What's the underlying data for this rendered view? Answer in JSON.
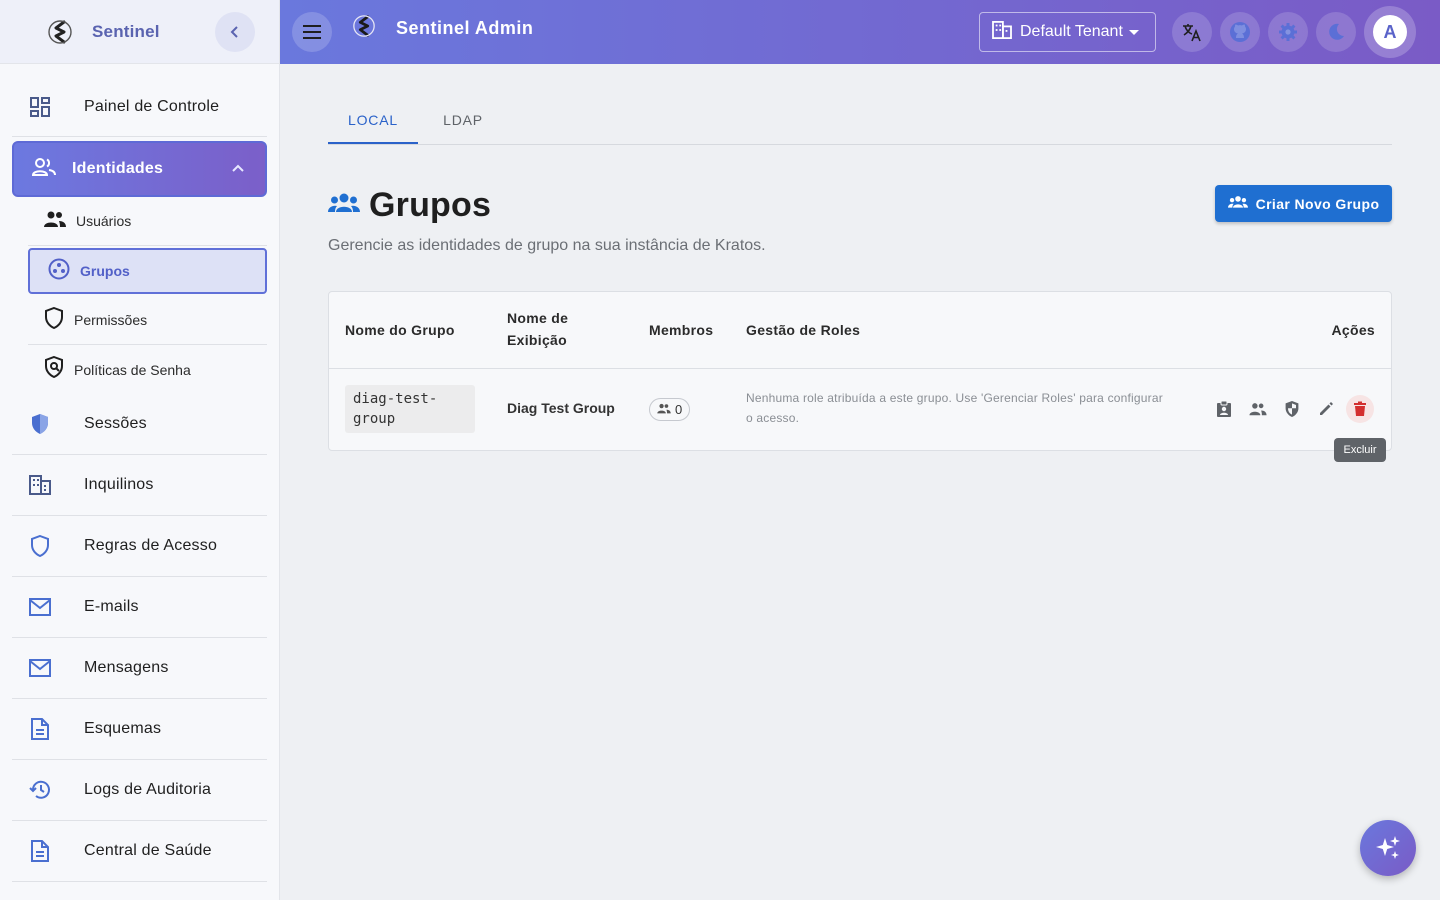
{
  "sidebar": {
    "brand": "Sentinel",
    "items": [
      {
        "label": "Painel de Controle",
        "icon": "dashboard-icon"
      },
      {
        "label": "Identidades",
        "icon": "people-icon",
        "expanded": true,
        "children": [
          {
            "label": "Usuários",
            "icon": "people-icon"
          },
          {
            "label": "Grupos",
            "icon": "groups-icon",
            "active": true
          },
          {
            "label": "Permissões",
            "icon": "shield-outline-icon"
          },
          {
            "label": "Políticas de Senha",
            "icon": "policy-icon"
          }
        ]
      },
      {
        "label": "Sessões",
        "icon": "security-icon"
      },
      {
        "label": "Inquilinos",
        "icon": "domain-icon"
      },
      {
        "label": "Regras de Acesso",
        "icon": "shield-outline-icon"
      },
      {
        "label": "E-mails",
        "icon": "mail-icon"
      },
      {
        "label": "Mensagens",
        "icon": "mail-icon"
      },
      {
        "label": "Esquemas",
        "icon": "document-icon"
      },
      {
        "label": "Logs de Auditoria",
        "icon": "history-icon"
      },
      {
        "label": "Central de Saúde",
        "icon": "document-icon"
      }
    ]
  },
  "topbar": {
    "title": "Sentinel Admin",
    "tenant": "Default Tenant",
    "avatar_initial": "A"
  },
  "tabs": [
    {
      "label": "LOCAL",
      "active": true
    },
    {
      "label": "LDAP",
      "active": false
    }
  ],
  "page": {
    "title": "Grupos",
    "subtitle": "Gerencie as identidades de grupo na sua instância de Kratos.",
    "create_button": "Criar Novo Grupo"
  },
  "table": {
    "headers": {
      "name": "Nome do Grupo",
      "display_line1": "Nome de",
      "display_line2": "Exibição",
      "members": "Membros",
      "roles": "Gestão de Roles",
      "actions": "Ações"
    },
    "rows": [
      {
        "name_line1": "diag-test-",
        "name_line2": "group",
        "display": "Diag Test Group",
        "members": "0",
        "roles_note": "Nenhuma role atribuída a este grupo. Use 'Gerenciar Roles' para configurar o acesso."
      }
    ]
  },
  "tooltip": "Excluir",
  "colors": {
    "accent": "#1f6fd1",
    "gradient_start": "#6a78dd",
    "gradient_end": "#7a5bc6",
    "danger": "#d32f2f"
  }
}
